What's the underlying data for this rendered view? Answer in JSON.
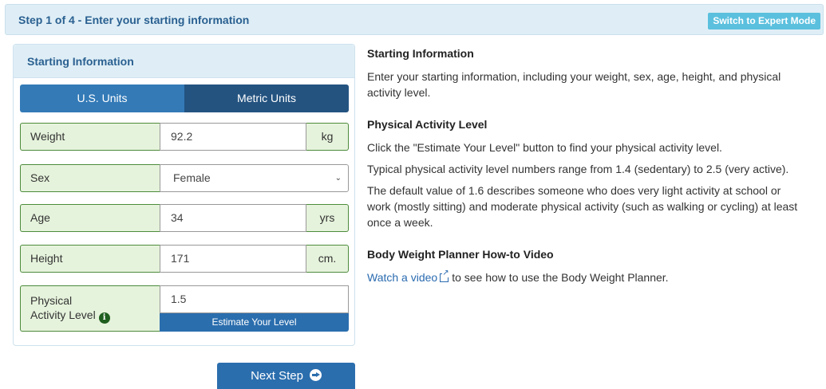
{
  "header": {
    "title": "Step 1 of 4 - Enter your starting information",
    "expert_mode_label": "Switch to Expert Mode"
  },
  "panel": {
    "title": "Starting Information",
    "units": {
      "us_label": "U.S. Units",
      "metric_label": "Metric Units",
      "selected": "Metric Units"
    },
    "weight": {
      "label": "Weight",
      "value": "92.2",
      "unit": "kg"
    },
    "sex": {
      "label": "Sex",
      "value": "Female"
    },
    "age": {
      "label": "Age",
      "value": "34",
      "unit": "yrs"
    },
    "height": {
      "label": "Height",
      "value": "171",
      "unit": "cm."
    },
    "activity": {
      "label_line1": "Physical",
      "label_line2": "Activity Level",
      "value": "1.5",
      "estimate_label": "Estimate Your Level"
    }
  },
  "next_button_label": "Next Step",
  "help": {
    "starting_title": "Starting Information",
    "starting_text": "Enter your starting information, including your weight, sex, age, height, and physical activity level.",
    "activity_title": "Physical Activity Level",
    "activity_text1": "Click the \"Estimate Your Level\" button to find your physical activity level.",
    "activity_text2": "Typical physical activity level numbers range from 1.4 (sedentary) to 2.5 (very active).",
    "activity_text3": "The default value of 1.6 describes someone who does very light activity at school or work (mostly sitting) and moderate physical activity (such as walking or cycling) at least once a week.",
    "video_title": "Body Weight Planner How-to Video",
    "video_link": "Watch a video",
    "video_text": "to see how to use the Body Weight Planner."
  }
}
